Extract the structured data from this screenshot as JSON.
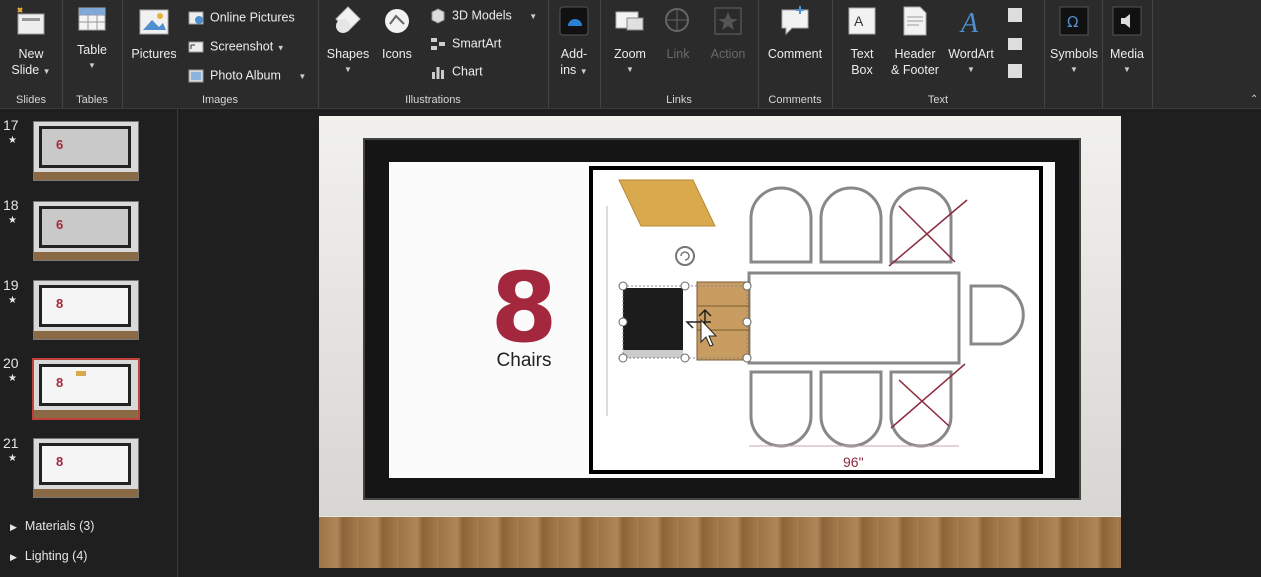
{
  "ribbon": {
    "groups": {
      "slides": "Slides",
      "tables": "Tables",
      "images": "Images",
      "illustrations": "Illustrations",
      "links": "Links",
      "comments": "Comments",
      "text": "Text"
    },
    "new_slide_l1": "New",
    "new_slide_l2": "Slide",
    "table": "Table",
    "pictures": "Pictures",
    "online_pictures": "Online Pictures",
    "screenshot": "Screenshot",
    "photo_album": "Photo Album",
    "shapes": "Shapes",
    "icons": "Icons",
    "models_3d": "3D Models",
    "smartart": "SmartArt",
    "chart": "Chart",
    "addins_l1": "Add-",
    "addins_l2": "ins",
    "zoom": "Zoom",
    "link": "Link",
    "action": "Action",
    "comment": "Comment",
    "textbox_l1": "Text",
    "textbox_l2": "Box",
    "header_l1": "Header",
    "header_l2": "& Footer",
    "wordart": "WordArt",
    "symbols": "Symbols",
    "media": "Media"
  },
  "thumbnails": [
    {
      "num": "17",
      "digit": "6"
    },
    {
      "num": "18",
      "digit": "6"
    },
    {
      "num": "19",
      "digit": "8"
    },
    {
      "num": "20",
      "digit": "8"
    },
    {
      "num": "21",
      "digit": "8"
    }
  ],
  "sections": {
    "materials": "Materials (3)",
    "lighting": "Lighting (4)"
  },
  "slide": {
    "number": "8",
    "caption": "Chairs",
    "dimension": "96\""
  },
  "colors": {
    "accent": "#a3283e",
    "selection": "#c0413b"
  }
}
